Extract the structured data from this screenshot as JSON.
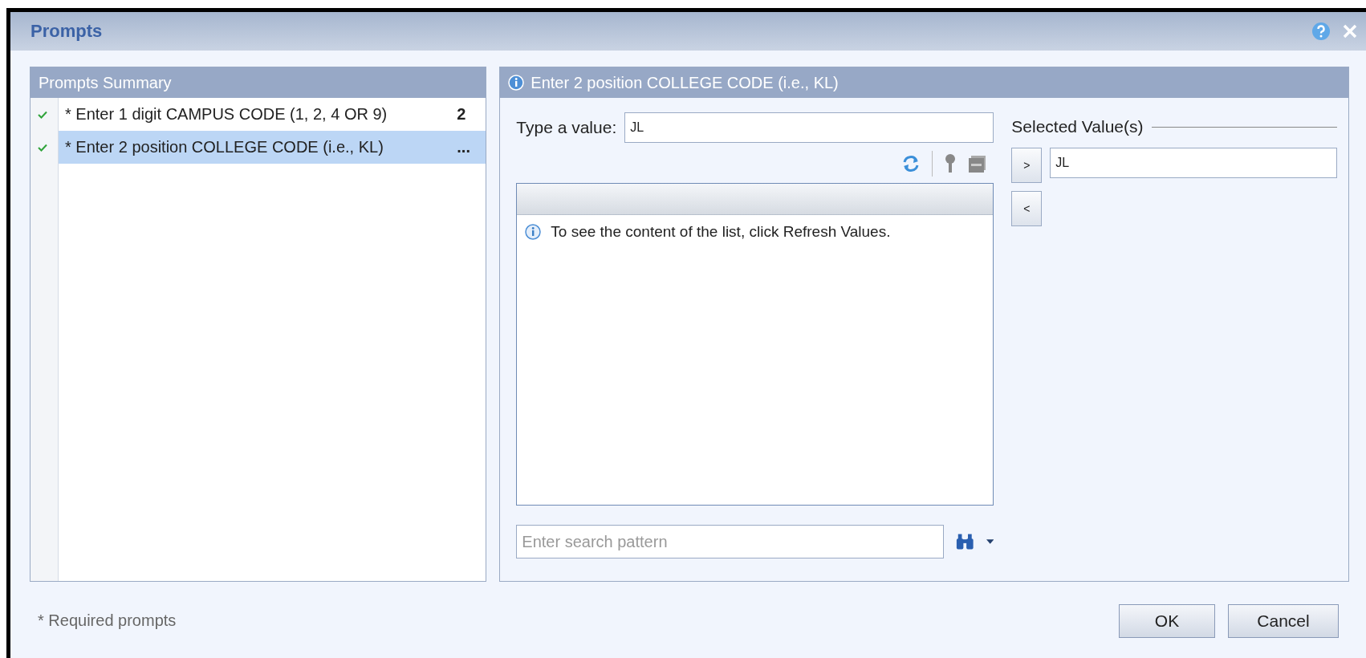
{
  "window": {
    "title": "Prompts"
  },
  "summary": {
    "title": "Prompts Summary",
    "items": [
      {
        "label": "* Enter 1 digit CAMPUS CODE (1, 2, 4 OR 9)",
        "value": "2",
        "checked": true,
        "selected": false
      },
      {
        "label": "* Enter 2 position COLLEGE CODE (i.e., KL)",
        "value": "...",
        "checked": true,
        "selected": true
      }
    ]
  },
  "detail": {
    "title": "Enter 2 position COLLEGE CODE (i.e., KL)",
    "type_label": "Type a value:",
    "type_value": "JL",
    "list_message": "To see the content of the list, click Refresh Values.",
    "search": {
      "placeholder": "Enter search pattern"
    },
    "selected_title": "Selected Value(s)",
    "add_button": ">",
    "remove_button": "<",
    "selected_values": [
      "JL"
    ]
  },
  "footer": {
    "note": "* Required prompts",
    "buttons": [
      "OK",
      "Cancel"
    ]
  }
}
